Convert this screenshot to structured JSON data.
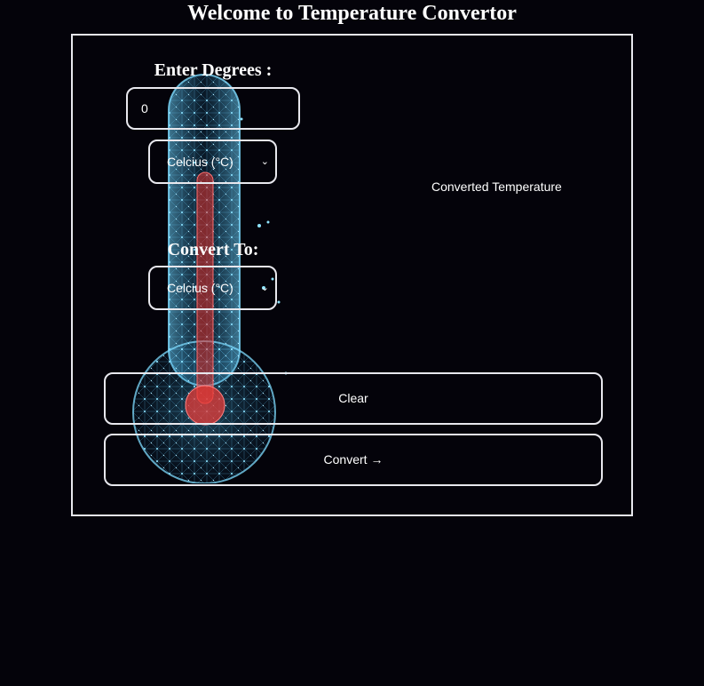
{
  "page": {
    "title": "Welcome to Temperature Convertor"
  },
  "form": {
    "degrees_label": "Enter Degrees :",
    "degrees_value": "0",
    "from_unit": {
      "selected": "Celcius (°C)"
    },
    "convert_to_label": "Convert To:",
    "to_unit": {
      "selected": "Celcius (°C)"
    },
    "clear_label": "Clear",
    "convert_label": "Convert →"
  },
  "output": {
    "result_text": "Converted Temperature"
  },
  "theme": {
    "background": "#04030a",
    "border": "#e8e8ee",
    "thermometer_glow": "#4fc3f7",
    "mercury": "#e53935"
  }
}
